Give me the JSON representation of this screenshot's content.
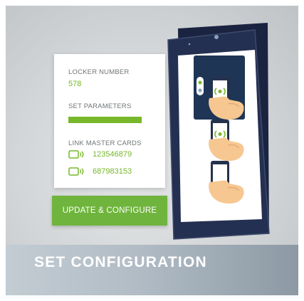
{
  "config_panel": {
    "locker_number_label": "LOCKER NUMBER",
    "locker_number_value": "578",
    "set_parameters_label": "SET PARAMETERS",
    "link_master_cards_label": "LINK MASTER CARDS",
    "master_cards": [
      "123546879",
      "687983153"
    ]
  },
  "update_button_label": "UPDATE & CONFIGURE",
  "banner_title": "SET CONFIGURATION",
  "icons": {
    "card": "card-icon",
    "nfc": "nfc-icon",
    "hand": "hand-with-phone-icon"
  },
  "colors": {
    "accent_green": "#76b82a",
    "button_green": "#6fb43c",
    "tablet_frame": "#1f2a44"
  }
}
